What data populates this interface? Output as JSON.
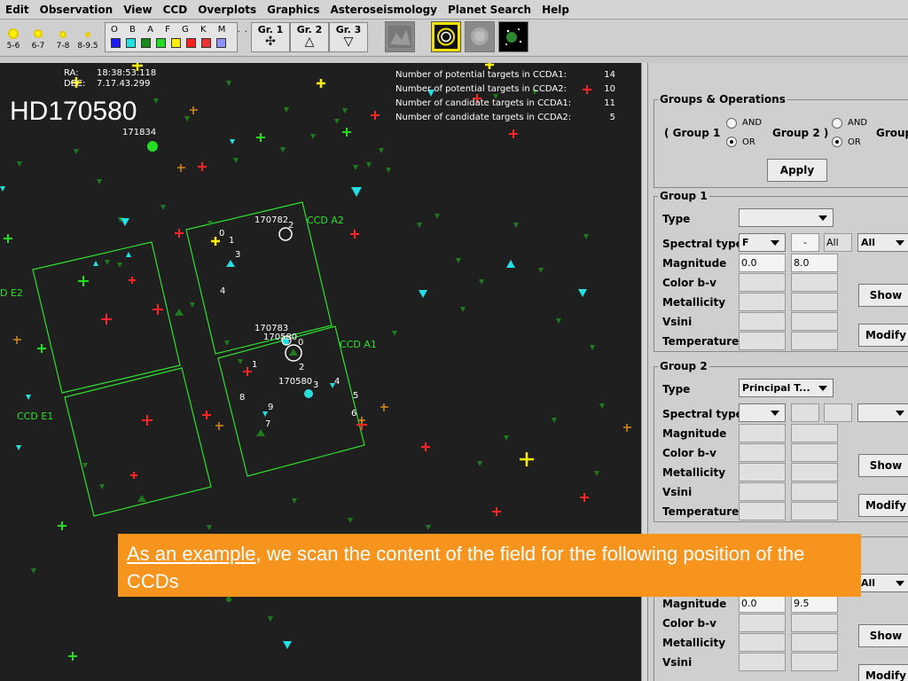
{
  "menu": [
    "Edit",
    "Observation",
    "View",
    "CCD",
    "Overplots",
    "Graphics",
    "Asteroseismology",
    "Planet Search",
    "Help"
  ],
  "toolbar": {
    "magnitudes": [
      "5-6",
      "6-7",
      "7-8",
      "8-9.5"
    ],
    "spectral_letters": "O B A F G K M ...",
    "spectral_colors": [
      "#1c1cff",
      "#25e0e0",
      "#1a8a1a",
      "#22dd22",
      "#ffee00",
      "#ff2020",
      "#ee3333",
      "#9090ff"
    ],
    "group_buttons": [
      {
        "label": "Gr. 1",
        "symbol": "✣"
      },
      {
        "label": "Gr. 2",
        "symbol": "△"
      },
      {
        "label": "Gr. 3",
        "symbol": "▽"
      }
    ]
  },
  "sky": {
    "ra_label": "RA:",
    "ra_value": "18:38:53.118",
    "dec_label": "DEC:",
    "dec_value": "7.17.43.299",
    "target_name": "HD170580",
    "counts": [
      {
        "label": "Number of potential targets in CCDA1:",
        "value": "14"
      },
      {
        "label": "Number of potential targets in CCDA2:",
        "value": "10"
      },
      {
        "label": "Number of candidate targets in CCDA1:",
        "value": "11"
      },
      {
        "label": "Number of candidate targets in CCDA2:",
        "value": "5"
      }
    ],
    "ccd_labels": {
      "a2": "CCD A2",
      "a1": "CCD A1",
      "e2": "D E2",
      "e1": "CCD E1"
    },
    "star_ids": {
      "s171834": "171834",
      "s170782": "170782",
      "s170783": "170783",
      "s170580": "170580",
      "s170580b": "170580"
    },
    "nums": [
      "0",
      "1",
      "3",
      "4",
      "2",
      "0",
      "1",
      "2",
      "3",
      "4",
      "5",
      "6",
      "7",
      "8",
      "9"
    ]
  },
  "panel": {
    "ops": {
      "title": "Groups & Operations",
      "group1": "( Group 1",
      "group2": "Group 2 )",
      "group3": "Group",
      "and": "AND",
      "or": "OR",
      "apply": "Apply"
    },
    "group1": {
      "title": "Group 1",
      "type_label": "Type",
      "type_value": "",
      "spectral_label": "Spectral type",
      "spectral_value": "F",
      "spectral_dash": "-",
      "spectral_to": "All",
      "spectral_sel2": "All",
      "magnitude_label": "Magnitude",
      "mag_min": "0.0",
      "mag_max": "8.0",
      "color_label": "Color b-v",
      "metal_label": "Metallicity",
      "vsini_label": "Vsini",
      "temp_label": "Temperature",
      "show": "Show",
      "modify": "Modify"
    },
    "group2": {
      "title": "Group 2",
      "type_label": "Type",
      "type_value": "Principal T...",
      "spectral_label": "Spectral type",
      "magnitude_label": "Magnitude",
      "color_label": "Color b-v",
      "metal_label": "Metallicity",
      "vsini_label": "Vsini",
      "temp_label": "Temperature",
      "show": "Show",
      "modify": "Modify"
    },
    "group3": {
      "spectral_sel2": "All",
      "magnitude_label": "Magnitude",
      "mag_min": "0.0",
      "mag_max": "9.5",
      "color_label": "Color b-v",
      "metal_label": "Metallicity",
      "vsini_label": "Vsini",
      "show": "Show",
      "modify": "Modify"
    }
  },
  "note": {
    "link": "As an example",
    "rest": ", we scan the content of the field for the following position of the CCDs"
  }
}
